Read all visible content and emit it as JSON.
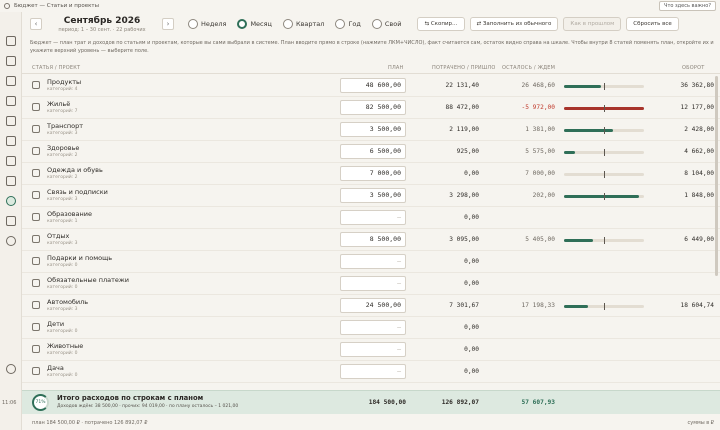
{
  "titlebar": {
    "title": "Бюджет — Статьи и проекты",
    "help": "Что здесь важно?"
  },
  "header": {
    "period_title": "Сентябрь 2026",
    "period_sub": "период: 1 – 30 сент. · 22 рабочих",
    "prev": "‹",
    "next": "›",
    "ranges": [
      {
        "label": "Неделя",
        "selected": false
      },
      {
        "label": "Месяц",
        "selected": true
      },
      {
        "label": "Квартал",
        "selected": false
      },
      {
        "label": "Год",
        "selected": false
      },
      {
        "label": "Свой",
        "selected": false
      }
    ],
    "btn_copy": "⇆ Скопир…",
    "btn_fill": "⇄ Заполнить из обычного",
    "btn_disabled": "Как в прошлом",
    "btn_reset": "Сбросить все"
  },
  "info": "Бюджет — план трат и доходов по статьям и проектам, которые вы сами выбрали в системе. План вводите прямо в строке (нажмите ЛКМ+ЧИСЛО), факт считается сам, остаток видно справа на шкале. Чтобы внутри 8 статей поменять план, откройте их и укажите верхний уровень — выберите поле.",
  "columns": {
    "name": "Статья / проект",
    "plan": "План",
    "fact": "Потрачено / пришло",
    "remaining": "Осталось / ждем",
    "total": "Оборот"
  },
  "rows": [
    {
      "icon": "cart-icon",
      "name": "Продукты",
      "sub": "категорий: 4",
      "plan": "48 600,00",
      "fact": "22 131,40",
      "remaining": "26 468,60",
      "over": false,
      "total": "36 362,80",
      "progress": 0.46
    },
    {
      "icon": "home-icon",
      "name": "Жильё",
      "sub": "категорий: 7",
      "plan": "82 500,00",
      "fact": "88 472,00",
      "remaining": "-5 972,00",
      "over": true,
      "total": "12 177,00",
      "progress": 1.0
    },
    {
      "icon": "bus-icon",
      "name": "Транспорт",
      "sub": "категорий: 3",
      "plan": "3 500,00",
      "fact": "2 119,00",
      "remaining": "1 381,00",
      "over": false,
      "total": "2 428,00",
      "progress": 0.61
    },
    {
      "icon": "heart-icon",
      "name": "Здоровье",
      "sub": "категорий: 2",
      "plan": "6 500,00",
      "fact": "925,00",
      "remaining": "5 575,00",
      "over": false,
      "total": "4 662,00",
      "progress": 0.14
    },
    {
      "icon": "shirt-icon",
      "name": "Одежда и обувь",
      "sub": "категорий: 2",
      "plan": "7 000,00",
      "fact": "0,00",
      "remaining": "7 000,00",
      "over": false,
      "total": "8 104,00",
      "progress": 0.0
    },
    {
      "icon": "phone-icon",
      "name": "Связь и подписки",
      "sub": "категорий: 3",
      "plan": "3 500,00",
      "fact": "3 298,00",
      "remaining": "202,00",
      "over": false,
      "total": "1 848,00",
      "progress": 0.94
    },
    {
      "icon": "edu-icon",
      "name": "Образование",
      "sub": "категорий: 1",
      "plan": "–",
      "fact": "0,00",
      "remaining": "",
      "over": false,
      "total": "",
      "progress": null
    },
    {
      "icon": "leisure-icon",
      "name": "Отдых",
      "sub": "категорий: 3",
      "plan": "8 500,00",
      "fact": "3 095,00",
      "remaining": "5 405,00",
      "over": false,
      "total": "6 449,00",
      "progress": 0.36
    },
    {
      "icon": "gift-icon",
      "name": "Подарки и помощь",
      "sub": "категорий: 0",
      "plan": "–",
      "fact": "0,00",
      "remaining": "",
      "over": false,
      "total": "",
      "progress": null
    },
    {
      "icon": "misc-icon",
      "name": "Обязательные платежи",
      "sub": "категорий: 0",
      "plan": "–",
      "fact": "0,00",
      "remaining": "",
      "over": false,
      "total": "",
      "progress": null
    },
    {
      "icon": "car-icon",
      "name": "Автомобиль",
      "sub": "категорий: 3",
      "plan": "24 500,00",
      "fact": "7 301,67",
      "remaining": "17 198,33",
      "over": false,
      "total": "18 604,74",
      "progress": 0.3
    },
    {
      "icon": "kids-icon",
      "name": "Дети",
      "sub": "категорий: 0",
      "plan": "–",
      "fact": "0,00",
      "remaining": "",
      "over": false,
      "total": "",
      "progress": null
    },
    {
      "icon": "pets-icon",
      "name": "Животные",
      "sub": "категорий: 0",
      "plan": "–",
      "fact": "0,00",
      "remaining": "",
      "over": false,
      "total": "",
      "progress": null
    },
    {
      "icon": "other-icon",
      "name": "Дача",
      "sub": "категорий: 0",
      "plan": "–",
      "fact": "0,00",
      "remaining": "",
      "over": false,
      "total": "",
      "progress": null
    }
  ],
  "total": {
    "ring": "71%",
    "name": "Итого расходов по строкам с планом",
    "sub": "Доходов ждём: 38 500,00 · прочих: 94 019,00 · по плану осталось – 1 021,00",
    "plan": "184 500,00",
    "fact": "126 892,07",
    "remaining": "57 607,93"
  },
  "status": {
    "left": "план 184 500,00 ₽  ·  потрачено 126 892,07 ₽",
    "right": "суммы в ₽"
  },
  "sidebar_time": "11:06"
}
